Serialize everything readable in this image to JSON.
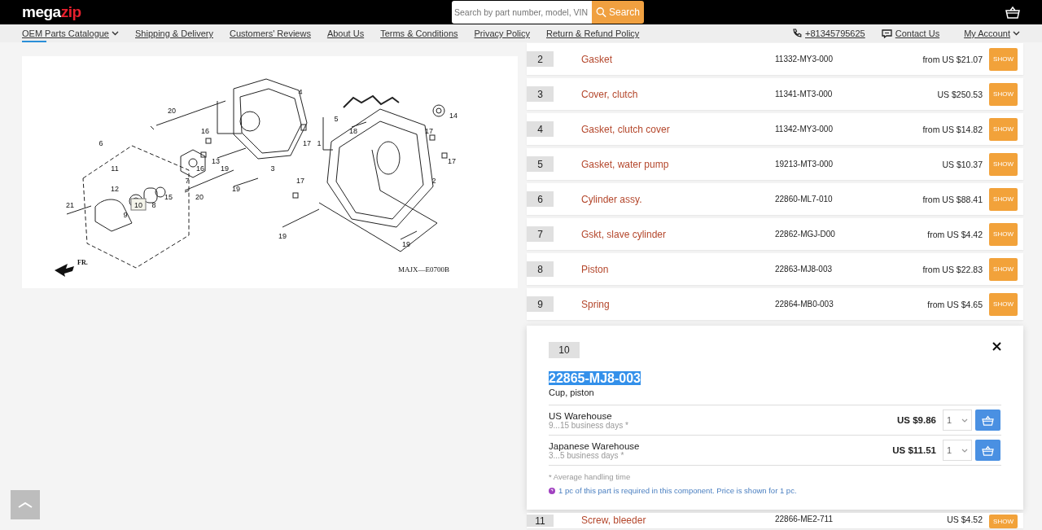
{
  "header": {
    "logo_left": "mega",
    "logo_right": "zip",
    "search": {
      "placeholder": "Search by part number, model, VIN",
      "button": "Search"
    }
  },
  "nav": {
    "links": [
      {
        "label": "OEM Parts Catalogue",
        "dropdown": true,
        "selected": true
      },
      {
        "label": "Shipping & Delivery",
        "dropdown": false,
        "selected": false
      },
      {
        "label": "Customers' Reviews",
        "dropdown": false,
        "selected": false
      },
      {
        "label": "About Us",
        "dropdown": false,
        "selected": false
      },
      {
        "label": "Terms & Conditions",
        "dropdown": false,
        "selected": false
      },
      {
        "label": "Privacy Policy",
        "dropdown": false,
        "selected": false
      },
      {
        "label": "Return & Refund Policy",
        "dropdown": false,
        "selected": false
      }
    ],
    "phone": "+81345795625",
    "contact": "Contact Us",
    "account": "My Account"
  },
  "diagram": {
    "callouts": [
      {
        "label": "4",
        "selected": false
      },
      {
        "label": "20",
        "selected": false
      },
      {
        "label": "14",
        "selected": false
      },
      {
        "label": "5",
        "selected": false
      },
      {
        "label": "16",
        "selected": false
      },
      {
        "label": "18",
        "selected": false
      },
      {
        "label": "17",
        "selected": false
      },
      {
        "label": "6",
        "selected": false
      },
      {
        "label": "17",
        "selected": false
      },
      {
        "label": "1",
        "selected": false
      },
      {
        "label": "13",
        "selected": false
      },
      {
        "label": "17",
        "selected": false
      },
      {
        "label": "11",
        "selected": false
      },
      {
        "label": "16",
        "selected": false
      },
      {
        "label": "19",
        "selected": false
      },
      {
        "label": "3",
        "selected": false
      },
      {
        "label": "7",
        "selected": false
      },
      {
        "label": "17",
        "selected": false
      },
      {
        "label": "2",
        "selected": false
      },
      {
        "label": "12",
        "selected": false
      },
      {
        "label": "19",
        "selected": false
      },
      {
        "label": "15",
        "selected": false
      },
      {
        "label": "20",
        "selected": false
      },
      {
        "label": "21",
        "selected": false
      },
      {
        "label": "10",
        "selected": true
      },
      {
        "label": "8",
        "selected": false
      },
      {
        "label": "9",
        "selected": false
      },
      {
        "label": "19",
        "selected": false
      },
      {
        "label": "19",
        "selected": false
      }
    ],
    "front_label": "FR.",
    "code": "MAJX—E0700B"
  },
  "parts": [
    {
      "number": "2",
      "name": "Gasket",
      "code": "11332-MY3-000",
      "price": "from US $21.07",
      "button": "SHOW"
    },
    {
      "number": "3",
      "name": "Cover, clutch",
      "code": "11341-MT3-000",
      "price": "US $250.53",
      "button": "SHOW"
    },
    {
      "number": "4",
      "name": "Gasket, clutch cover",
      "code": "11342-MY3-000",
      "price": "from US $14.82",
      "button": "SHOW"
    },
    {
      "number": "5",
      "name": "Gasket, water pump",
      "code": "19213-MT3-000",
      "price": "US $10.37",
      "button": "SHOW"
    },
    {
      "number": "6",
      "name": "Cylinder assy.",
      "code": "22860-ML7-010",
      "price": "from US $88.41",
      "button": "SHOW"
    },
    {
      "number": "7",
      "name": "Gskt, slave cylinder",
      "code": "22862-MGJ-D00",
      "price": "from US $4.42",
      "button": "SHOW"
    },
    {
      "number": "8",
      "name": "Piston",
      "code": "22863-MJ8-003",
      "price": "from US $22.83",
      "button": "SHOW"
    },
    {
      "number": "9",
      "name": "Spring",
      "code": "22864-MB0-003",
      "price": "from US $4.65",
      "button": "SHOW"
    }
  ],
  "detail": {
    "number": "10",
    "code": "22865-MJ8-003",
    "code_highlighted": true,
    "name": "Cup, piston",
    "offers": [
      {
        "warehouse": "US Warehouse",
        "delivery": "9...15 business days *",
        "price": "US $9.86",
        "quantity": "1"
      },
      {
        "warehouse": "Japanese Warehouse",
        "delivery": "3...5 business days *",
        "price": "US $11.51",
        "quantity": "1"
      }
    ],
    "footnote": "* Average handling time",
    "info": "1 pc of this part is required in this component. Price is shown for 1 pc."
  },
  "next_part": {
    "number": "11",
    "name": "Screw, bleeder",
    "code": "22866-ME2-711",
    "price": "US $4.52",
    "button": "SHOW"
  }
}
